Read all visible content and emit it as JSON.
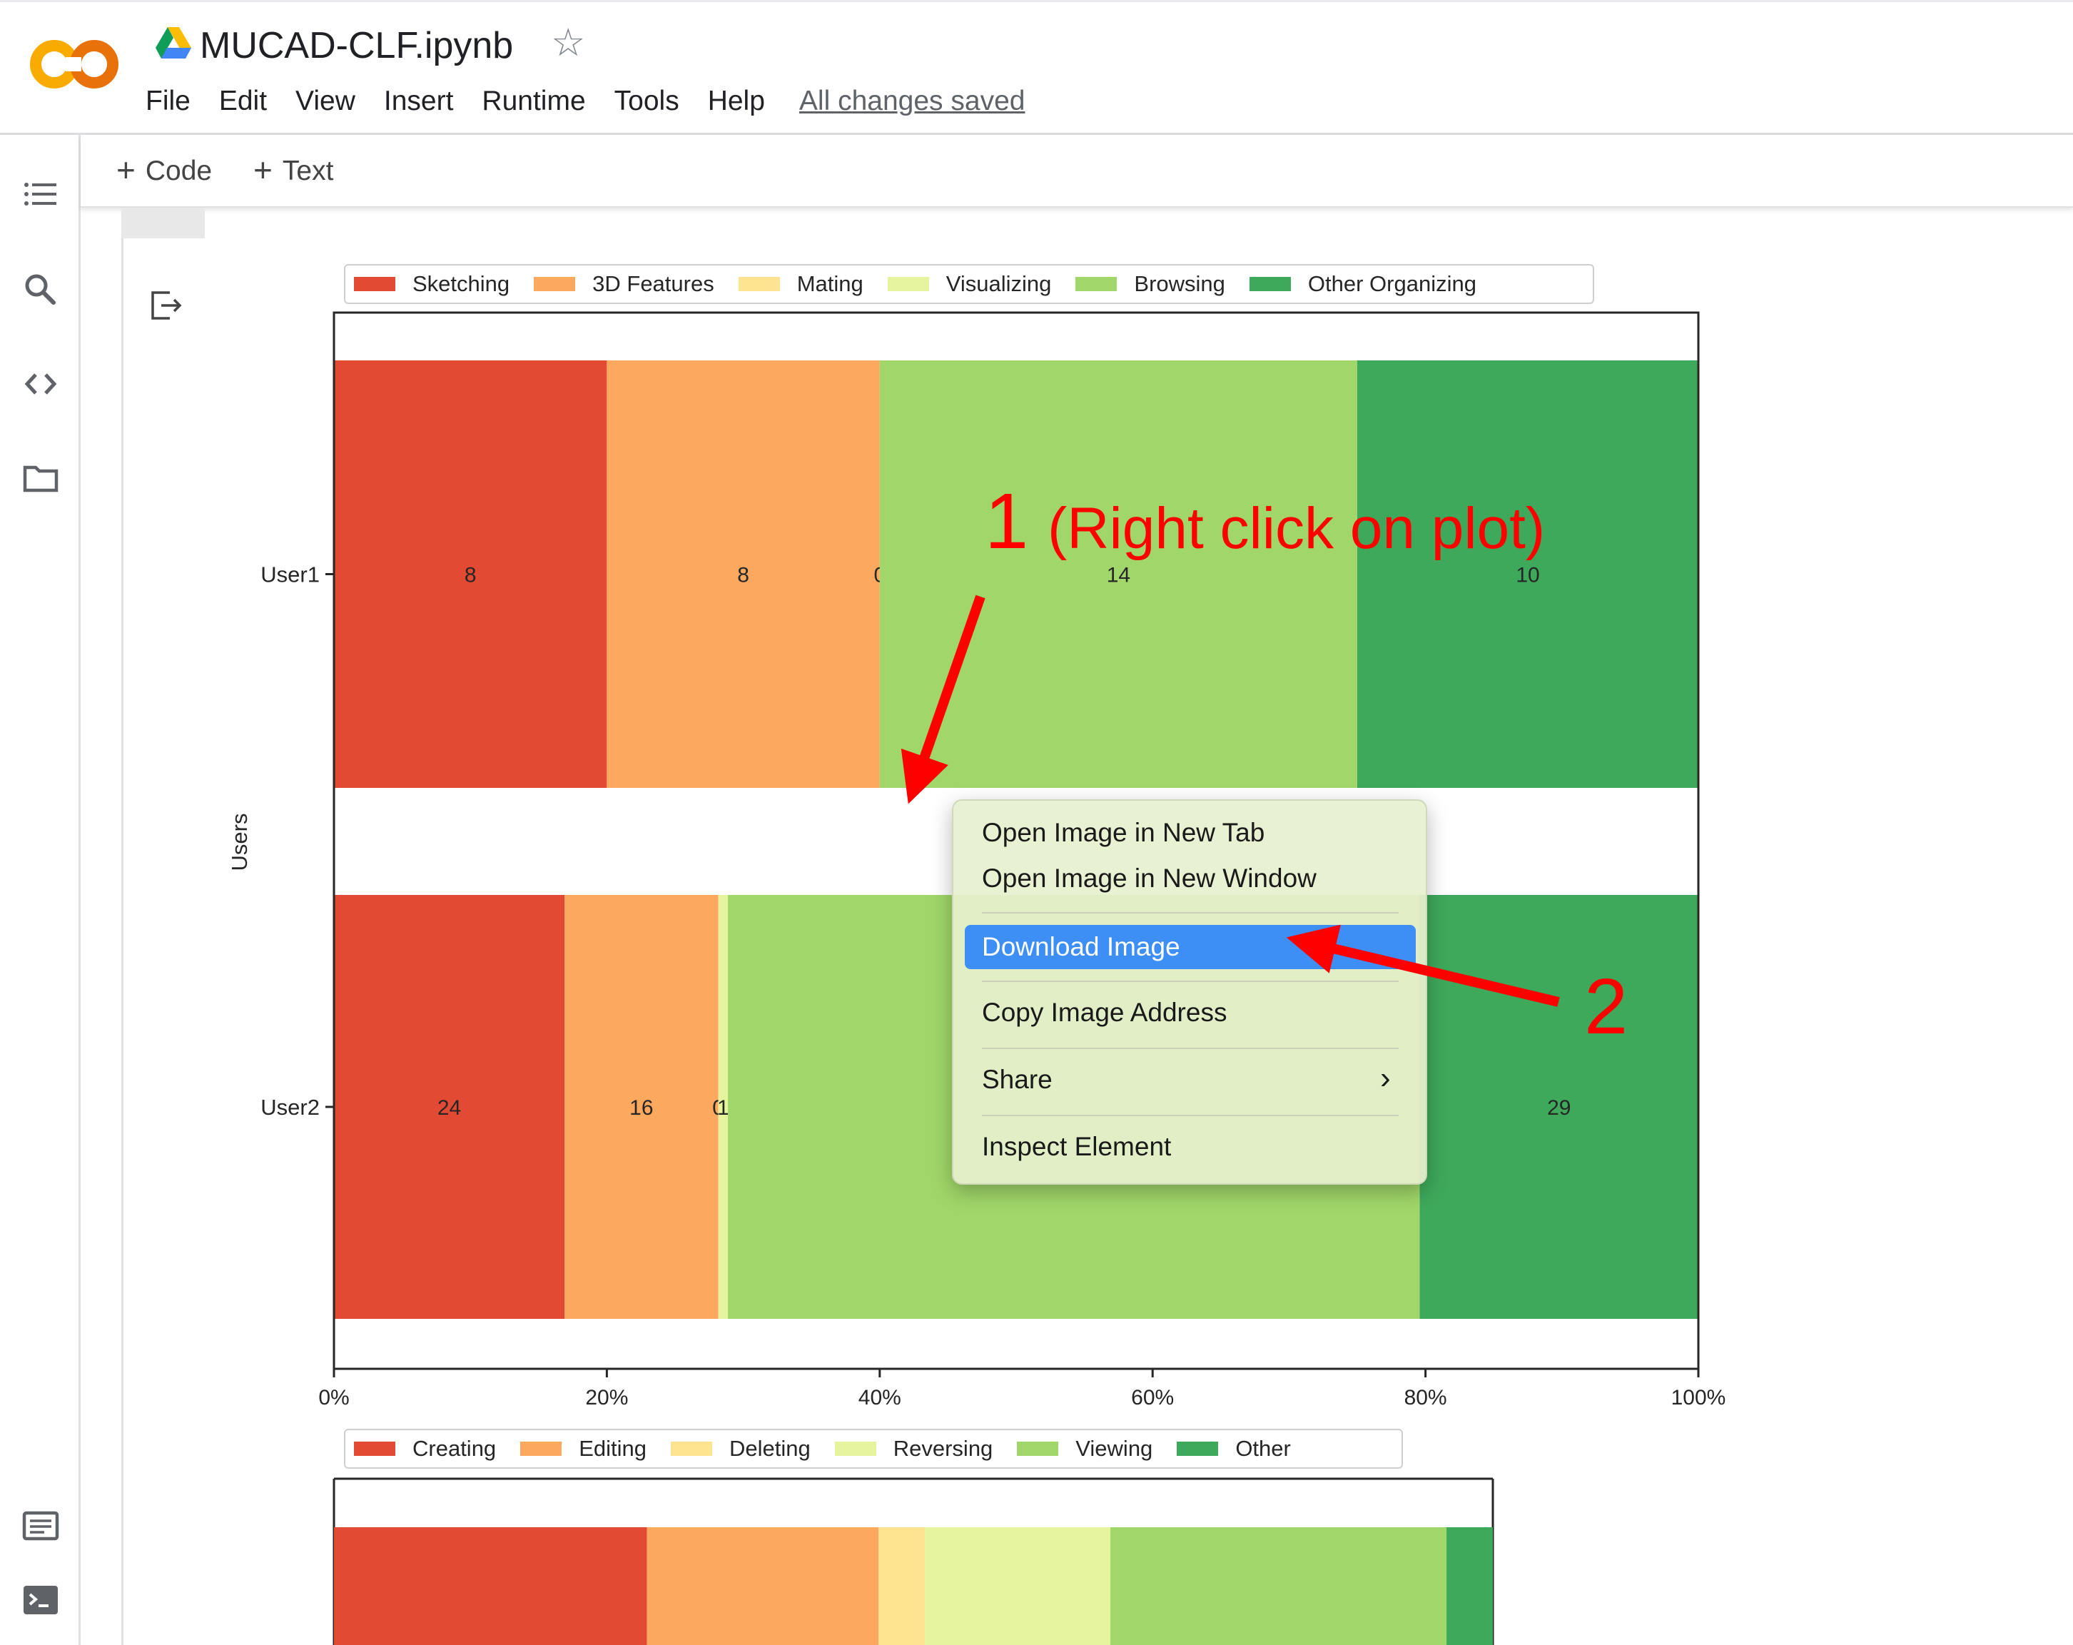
{
  "app": {
    "logo": "colab-logo",
    "drive_icon": "google-drive-icon",
    "notebook_title": "MUCAD-CLF.ipynb",
    "star_icon": "star-icon",
    "star_glyph": "☆",
    "menu": [
      "File",
      "Edit",
      "View",
      "Insert",
      "Runtime",
      "Tools",
      "Help"
    ],
    "save_status": "All changes saved"
  },
  "sidebar": {
    "icons": [
      "table-of-contents-icon",
      "search-icon",
      "code-snippets-icon",
      "files-icon",
      "command-palette-icon",
      "terminal-icon"
    ]
  },
  "toolbar": {
    "add_code": "Code",
    "add_text": "Text",
    "plus": "+"
  },
  "chart_data": [
    {
      "type": "bar",
      "orientation": "horizontal",
      "stacked": "percent",
      "categories": [
        "User1",
        "User2"
      ],
      "ylabel": "Users",
      "xlim": [
        0,
        100
      ],
      "x_tick_labels": [
        "0%",
        "20%",
        "40%",
        "60%",
        "80%",
        "100%"
      ],
      "legend_position": "top",
      "series": [
        {
          "name": "Sketching",
          "values": [
            8,
            24
          ],
          "labels": [
            "8",
            "24"
          ],
          "color": "#e34a33"
        },
        {
          "name": "3D Features",
          "values": [
            8,
            16
          ],
          "labels": [
            "8",
            "16"
          ],
          "color": "#fca85e"
        },
        {
          "name": "Mating",
          "values": [
            0,
            0
          ],
          "labels": [
            "0",
            "0"
          ],
          "color": "#fee391"
        },
        {
          "name": "Visualizing",
          "values": [
            0,
            1
          ],
          "labels": [
            "",
            "1"
          ],
          "color": "#e6f59d"
        },
        {
          "name": "Browsing",
          "values": [
            14,
            72
          ],
          "labels": [
            "14",
            ""
          ],
          "color": "#a1d76a"
        },
        {
          "name": "Other Organizing",
          "values": [
            10,
            29
          ],
          "labels": [
            "10",
            "29"
          ],
          "color": "#3ea95a"
        }
      ]
    },
    {
      "type": "bar",
      "orientation": "horizontal",
      "stacked": "percent",
      "categories": [
        ""
      ],
      "legend_position": "top",
      "series": [
        {
          "name": "Creating",
          "values": [
            27
          ],
          "color": "#e34a33"
        },
        {
          "name": "Editing",
          "values": [
            20
          ],
          "color": "#fca85e"
        },
        {
          "name": "Deleting",
          "values": [
            4
          ],
          "color": "#fee391"
        },
        {
          "name": "Reversing",
          "values": [
            16
          ],
          "color": "#e6f59d"
        },
        {
          "name": "Viewing",
          "values": [
            29
          ],
          "color": "#a1d76a"
        },
        {
          "name": "Other",
          "values": [
            4
          ],
          "color": "#3ea95a"
        }
      ]
    }
  ],
  "context_menu": {
    "items": [
      "Open Image in New Tab",
      "Open Image in New Window",
      "Download Image",
      "Copy Image Address",
      "Share",
      "Inspect Element"
    ],
    "highlighted": "Download Image",
    "highlight_color": "#3d8ef5",
    "submenu_glyph": "›"
  },
  "annotations": {
    "step1_number": "1",
    "step1_text": "(Right click on plot)",
    "step2_number": "2",
    "color": "#ff0000"
  }
}
